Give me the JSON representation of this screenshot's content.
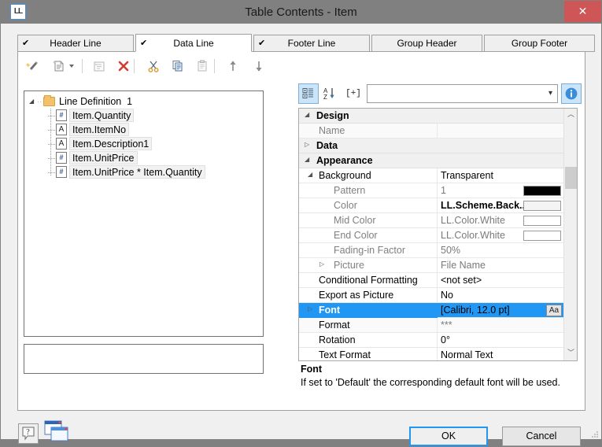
{
  "window": {
    "title": "Table Contents - Item",
    "app_icon_text": "LL",
    "close_label": "✕"
  },
  "tabs": [
    {
      "label": "Header Line",
      "checked": true,
      "active": false
    },
    {
      "label": "Data Line",
      "checked": true,
      "active": true
    },
    {
      "label": "Footer Line",
      "checked": true,
      "active": false
    },
    {
      "label": "Group Header",
      "checked": false,
      "active": false
    },
    {
      "label": "Group Footer",
      "checked": false,
      "active": false
    }
  ],
  "left_toolbar": {
    "buttons": [
      {
        "name": "wizard-icon",
        "tooltip": "Wizard",
        "enabled": true
      },
      {
        "name": "new-field-icon",
        "tooltip": "New Field",
        "enabled": true
      },
      {
        "name": "dropdown-arrow-icon",
        "tooltip": "More",
        "enabled": true
      },
      {
        "name": "properties-icon",
        "tooltip": "Properties",
        "enabled": false
      },
      {
        "name": "delete-icon",
        "tooltip": "Delete",
        "enabled": true
      },
      {
        "name": "cut-icon",
        "tooltip": "Cut",
        "enabled": true
      },
      {
        "name": "copy-icon",
        "tooltip": "Copy",
        "enabled": true
      },
      {
        "name": "paste-icon",
        "tooltip": "Paste",
        "enabled": false
      },
      {
        "name": "move-up-icon",
        "tooltip": "Move Up",
        "enabled": true
      },
      {
        "name": "move-down-icon",
        "tooltip": "Move Down",
        "enabled": true
      }
    ]
  },
  "tree": {
    "root": {
      "label": "Line Definition",
      "index": "1",
      "icon": "folder-icon",
      "expanded": true
    },
    "children": [
      {
        "label": "Item.Quantity",
        "icon_kind": "number"
      },
      {
        "label": "Item.ItemNo",
        "icon_kind": "text"
      },
      {
        "label": "Item.Description1",
        "icon_kind": "text"
      },
      {
        "label": "Item.UnitPrice",
        "icon_kind": "number"
      },
      {
        "label": "Item.UnitPrice * Item.Quantity",
        "icon_kind": "number"
      }
    ]
  },
  "property_toolbar": {
    "categorized_label": "",
    "alphabetical_label": "",
    "expand_label": "[+]",
    "search_value": "",
    "search_placeholder": "",
    "info_label": "i"
  },
  "properties": [
    {
      "kind": "category",
      "expander": "down",
      "name": "Design",
      "value": ""
    },
    {
      "kind": "prop",
      "indent": 1,
      "name": "Name",
      "value": "",
      "name_grey": true,
      "alt": true
    },
    {
      "kind": "category",
      "expander": "right",
      "name": "Data",
      "value": ""
    },
    {
      "kind": "category",
      "expander": "down",
      "name": "Appearance",
      "value": ""
    },
    {
      "kind": "prop",
      "indent": 1,
      "expander": "down",
      "name": "Background",
      "value": "Transparent"
    },
    {
      "kind": "prop",
      "indent": 2,
      "name": "Pattern",
      "value": "1",
      "name_grey": true,
      "value_grey": true,
      "swatch": "#000000"
    },
    {
      "kind": "prop",
      "indent": 2,
      "name": "Color",
      "value": "LL.Scheme.Back...",
      "name_grey": true,
      "value_bold": true,
      "swatch": "#f4f4f4"
    },
    {
      "kind": "prop",
      "indent": 2,
      "name": "Mid Color",
      "value": "LL.Color.White",
      "name_grey": true,
      "value_grey": true,
      "swatch": "#ffffff"
    },
    {
      "kind": "prop",
      "indent": 2,
      "name": "End Color",
      "value": "LL.Color.White",
      "name_grey": true,
      "value_grey": true,
      "swatch": "#ffffff"
    },
    {
      "kind": "prop",
      "indent": 2,
      "name": "Fading-in Factor",
      "value": "50%",
      "name_grey": true,
      "value_grey": true
    },
    {
      "kind": "prop",
      "indent": 2,
      "expander": "right",
      "name": "Picture",
      "value": "File Name",
      "name_grey": true,
      "value_grey": true
    },
    {
      "kind": "prop",
      "indent": 1,
      "name": "Conditional Formatting",
      "value": "<not set>"
    },
    {
      "kind": "prop",
      "indent": 1,
      "name": "Export as Picture",
      "value": "No"
    },
    {
      "kind": "prop",
      "indent": 1,
      "expander": "right",
      "name": "Font",
      "value": "[Calibri, 12.0 pt]",
      "selected": true,
      "aa": "Aa"
    },
    {
      "kind": "prop",
      "indent": 1,
      "name": "Format",
      "value": "***",
      "value_grey": true,
      "alt": true
    },
    {
      "kind": "prop",
      "indent": 1,
      "name": "Rotation",
      "value": "0°"
    },
    {
      "kind": "prop",
      "indent": 1,
      "name": "Text Format",
      "value": "Normal Text"
    }
  ],
  "help": {
    "title": "Font",
    "text": "If set to 'Default' the corresponding default font will be used."
  },
  "footer": {
    "help_icon": "?",
    "windows_icon": "windows-icon",
    "ok_label": "OK",
    "cancel_label": "Cancel"
  },
  "colors": {
    "titlebar": "#808080",
    "close": "#cf5656",
    "accent": "#2196f3",
    "dialog_bg": "#f0f0f0"
  }
}
